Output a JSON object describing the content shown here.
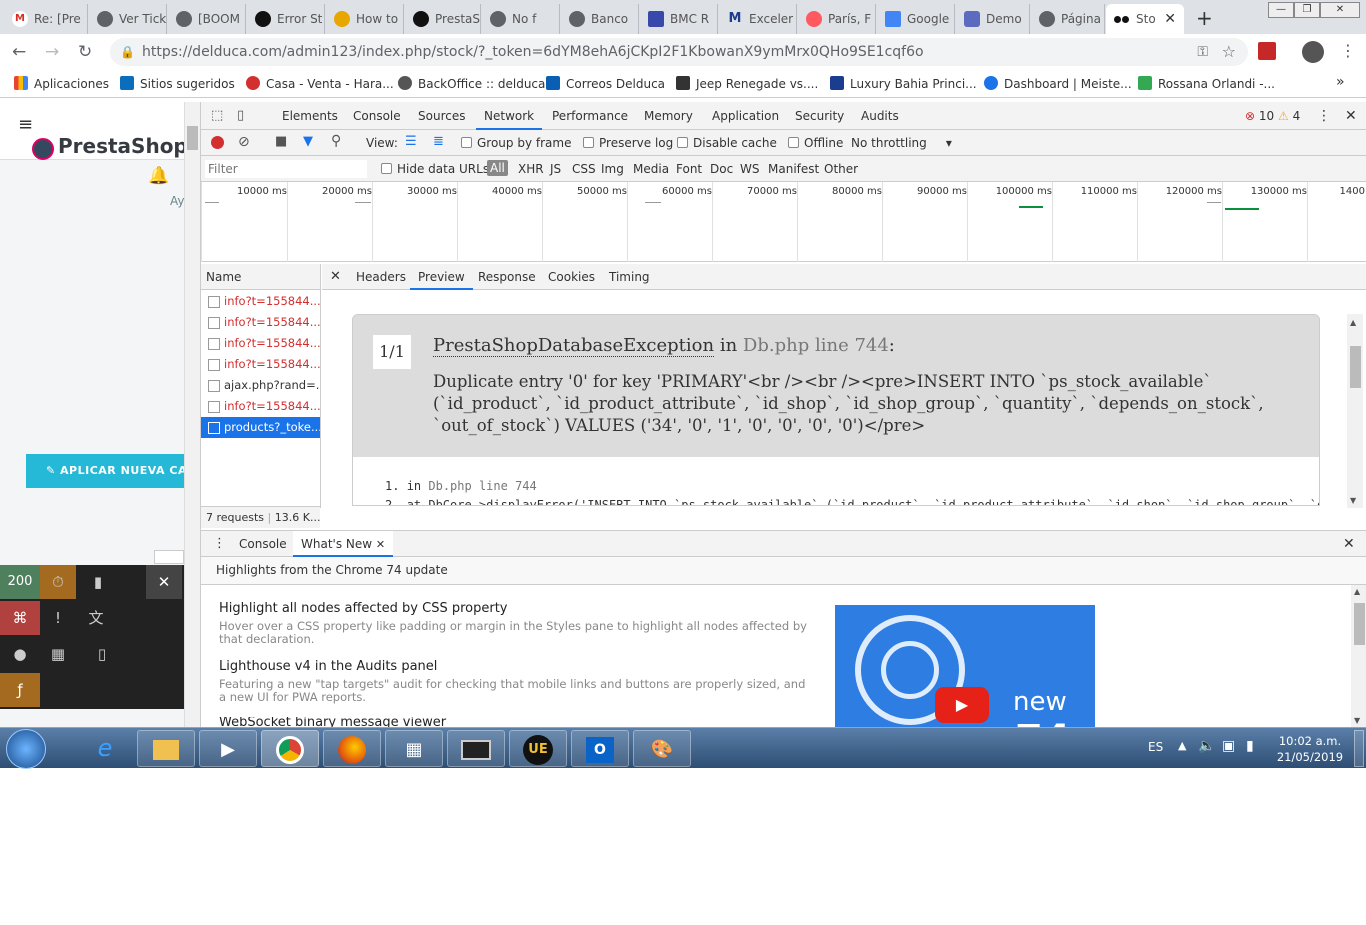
{
  "tabs": [
    {
      "label": "Re: [Pre",
      "icon": "gmail-icon"
    },
    {
      "label": "Ver Tick",
      "icon": "globe-icon"
    },
    {
      "label": "[BOOM",
      "icon": "globe-icon"
    },
    {
      "label": "Error St",
      "icon": "github-icon"
    },
    {
      "label": "How to",
      "icon": "trophy-icon"
    },
    {
      "label": "PrestaS",
      "icon": "github-icon"
    },
    {
      "label": "No f",
      "icon": "globe-icon"
    },
    {
      "label": "Banco",
      "icon": "globe-icon"
    },
    {
      "label": "BMC R",
      "icon": "bmc-icon"
    },
    {
      "label": "Exceler",
      "icon": "m-icon"
    },
    {
      "label": "París, F",
      "icon": "airbnb-icon"
    },
    {
      "label": "Google",
      "icon": "translate-icon"
    },
    {
      "label": "Demo",
      "icon": "demo-icon"
    },
    {
      "label": "Página",
      "icon": "globe-icon"
    },
    {
      "label": "Sto",
      "icon": "flickr-icon"
    }
  ],
  "url": "https://delduca.com/admin123/index.php/stock/?_token=6dYM8ehA6jCKpI2F1KbowanX9ymMrx0QHo9SE1cqf6o",
  "bookmarks": [
    {
      "label": "Aplicaciones",
      "color": "#4285f4"
    },
    {
      "label": "Sitios sugeridos",
      "color": "#1a73e8"
    },
    {
      "label": "Casa - Venta - Hara...",
      "color": "#d32f2f"
    },
    {
      "label": "BackOffice :: delduca",
      "color": "#555"
    },
    {
      "label": "Correos Delduca",
      "color": "#0a5fb4"
    },
    {
      "label": "Jeep Renegade vs....",
      "color": "#333"
    },
    {
      "label": "Luxury Bahia Princi...",
      "color": "#1a3d8f"
    },
    {
      "label": "Dashboard | Meiste...",
      "color": "#1a73e8"
    },
    {
      "label": "Rossana Orlandi -...",
      "color": "#34a853"
    }
  ],
  "page": {
    "brand": "PrestaShop",
    "help_short": "Ay",
    "apply_button": "APLICAR NUEVA CA",
    "symfony_status": "200"
  },
  "devtools": {
    "tabs": [
      "Elements",
      "Console",
      "Sources",
      "Network",
      "Performance",
      "Memory",
      "Application",
      "Security",
      "Audits"
    ],
    "active_tab": "Network",
    "errors": "10",
    "warnings": "4",
    "toolbar": {
      "view": "View:",
      "group_by_frame": "Group by frame",
      "preserve_log": "Preserve log",
      "disable_cache": "Disable cache",
      "offline": "Offline",
      "throttling": "No throttling"
    },
    "filter_placeholder": "Filter",
    "hide_data_urls": "Hide data URLs",
    "filter_types": [
      "All",
      "XHR",
      "JS",
      "CSS",
      "Img",
      "Media",
      "Font",
      "Doc",
      "WS",
      "Manifest",
      "Other"
    ],
    "timeline_ticks": [
      "10000 ms",
      "20000 ms",
      "30000 ms",
      "40000 ms",
      "50000 ms",
      "60000 ms",
      "70000 ms",
      "80000 ms",
      "90000 ms",
      "100000 ms",
      "110000 ms",
      "120000 ms",
      "130000 ms",
      "1400"
    ],
    "name_header": "Name",
    "requests": [
      {
        "name": "info?t=155844...",
        "status": "error"
      },
      {
        "name": "info?t=155844...",
        "status": "error"
      },
      {
        "name": "info?t=155844...",
        "status": "error"
      },
      {
        "name": "info?t=155844...",
        "status": "error"
      },
      {
        "name": "ajax.php?rand=...",
        "status": "ok"
      },
      {
        "name": "info?t=155844...",
        "status": "error"
      },
      {
        "name": "products?_toke...",
        "status": "selected"
      }
    ],
    "summary": "7 requests",
    "summary_size": "13.6 K...",
    "detail_tabs": [
      "Headers",
      "Preview",
      "Response",
      "Cookies",
      "Timing"
    ],
    "active_detail": "Preview",
    "exception": {
      "counter": "1/1",
      "class": "PrestaShopDatabaseException",
      "in": "in",
      "file": "Db.php line 744",
      "colon": ":",
      "message": "Duplicate entry '0' for key 'PRIMARY'<br /><br /><pre>INSERT INTO `ps_stock_available` (`id_product`, `id_product_attribute`, `id_shop`, `id_shop_group`, `quantity`, `depends_on_stock`, `out_of_stock`) VALUES ('34', '0', '1', '0', '0', '0', '0')</pre>",
      "trace": [
        {
          "num": "1.",
          "text": "in",
          "link": "Db.php line 744"
        },
        {
          "num": "2.",
          "text": "at DbCore->displayError('INSERT INTO `ps_stock_available` (`id_product`, `id_product_attribute`, `id_shop`, `id_shop_group`, `quantity`,",
          "link": ""
        }
      ]
    },
    "drawer": {
      "tabs": [
        "Console",
        "What's New"
      ],
      "active": "What's New",
      "subtitle": "Highlights from the Chrome 74 update",
      "items": [
        {
          "title": "Highlight all nodes affected by CSS property",
          "desc": "Hover over a CSS property like padding or margin in the Styles pane to highlight all nodes affected by that declaration."
        },
        {
          "title": "Lighthouse v4 in the Audits panel",
          "desc": "Featuring a new \"tap targets\" audit for checking that mobile links and buttons are properly sized, and a new UI for PWA reports."
        },
        {
          "title": "WebSocket binary message viewer",
          "desc": ""
        }
      ],
      "video_label": "new",
      "video_number": "74"
    }
  },
  "taskbar": {
    "lang": "ES",
    "time": "10:02 a.m.",
    "date": "21/05/2019"
  }
}
